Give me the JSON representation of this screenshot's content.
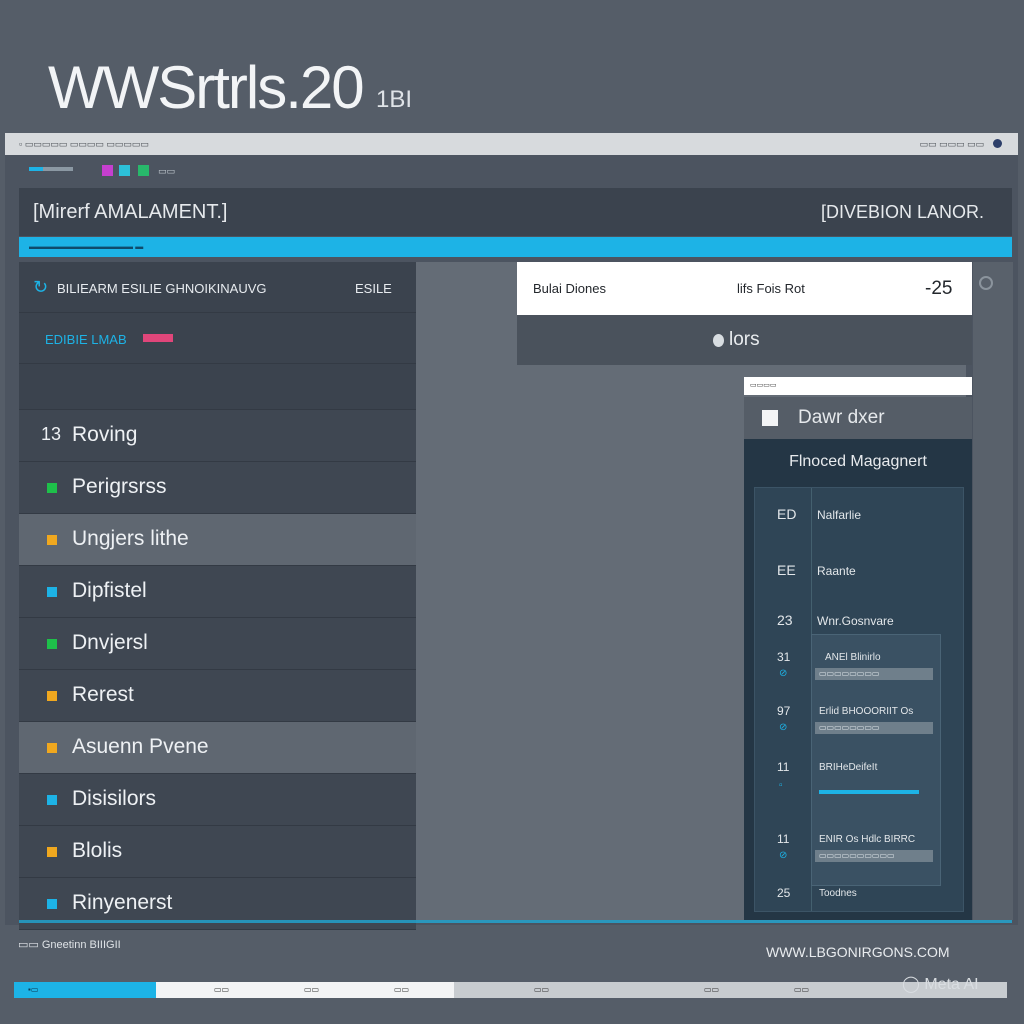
{
  "hero": {
    "title": "WWSrtrls.20",
    "suffix": "1BI"
  },
  "titlebar": {
    "left_text": "▫  ▭▭▭▭▭  ▭▭▭▭  ▭▭▭▭▭",
    "right_text": "▭▭ ▭▭▭ ▭▭"
  },
  "toolbar": {
    "label": "▭▭",
    "colors": [
      "#1db3e6",
      "#c63fcf",
      "#2cc0d9",
      "#28b86b"
    ]
  },
  "header": {
    "title": "[Mirerf AMALAMENT.]",
    "right": "[DIVEBION LANOR."
  },
  "accent_bar": {
    "text": "▬▬▬▬▬▬▬▬▬▬▬▬▬ ▬"
  },
  "sidebar": {
    "head1": {
      "text": "BILIEARM ESILIE GHNOIKINAUVG",
      "right": "ESILE"
    },
    "head2": {
      "text": "EDIBIE  LMAB"
    },
    "items": [
      {
        "icon": "13",
        "label": "Roving",
        "color": ""
      },
      {
        "label": "Perigrsrss",
        "color": "#1ec04a"
      },
      {
        "label": "Ungjers lithe",
        "color": "#f0a81f",
        "active": true
      },
      {
        "label": "Dipfistel",
        "color": "#1db3e6"
      },
      {
        "label": "Dnvjersl",
        "color": "#1ec04a"
      },
      {
        "label": "Rerest",
        "color": "#f0a81f"
      },
      {
        "label": "Asuenn Pvene",
        "color": "#f0a81f",
        "active": true
      },
      {
        "label": "Disisilors",
        "color": "#1db3e6"
      },
      {
        "label": "Blolis",
        "color": "#f0a81f"
      },
      {
        "label": "Rinyenerst",
        "color": "#1db3e6"
      }
    ]
  },
  "card": {
    "col1": "Bulai Diones",
    "col2": "lifs Fois Rot",
    "value": "-25",
    "sub": "lors"
  },
  "right": {
    "mini": "▭▭▭▭",
    "header": "Dawr dxer",
    "panel_title": "Flnoced Magagnert",
    "rows": [
      {
        "num": "ED",
        "text": "Nalfarlie"
      },
      {
        "num": "EE",
        "text": "Raante"
      },
      {
        "num": "23",
        "text": "Wnr.Gosnvare"
      }
    ],
    "subrows": [
      {
        "num": "31",
        "text": "ANEl Blinirlo",
        "bar": "▭▭▭▭▭▭▭▭"
      },
      {
        "num": "97",
        "text": "Erlid BHOOORIIT Os",
        "bar": "▭▭▭▭▭▭▭▭"
      },
      {
        "num": "11",
        "text": "BRIHeDeifeIt",
        "bar": ""
      },
      {
        "num": "11",
        "text": "ENIR Os Hdlc BIRRC",
        "bar": "▭▭▭▭▭▭▭▭▭▭"
      },
      {
        "num": "25",
        "text": "Toodnes",
        "bar": ""
      }
    ]
  },
  "footer": {
    "status": "▭▭ Gneetinn BIIIGII",
    "url": "WWW.LBGONIRGONS.COM",
    "watermark": "◯ Meta AI"
  }
}
